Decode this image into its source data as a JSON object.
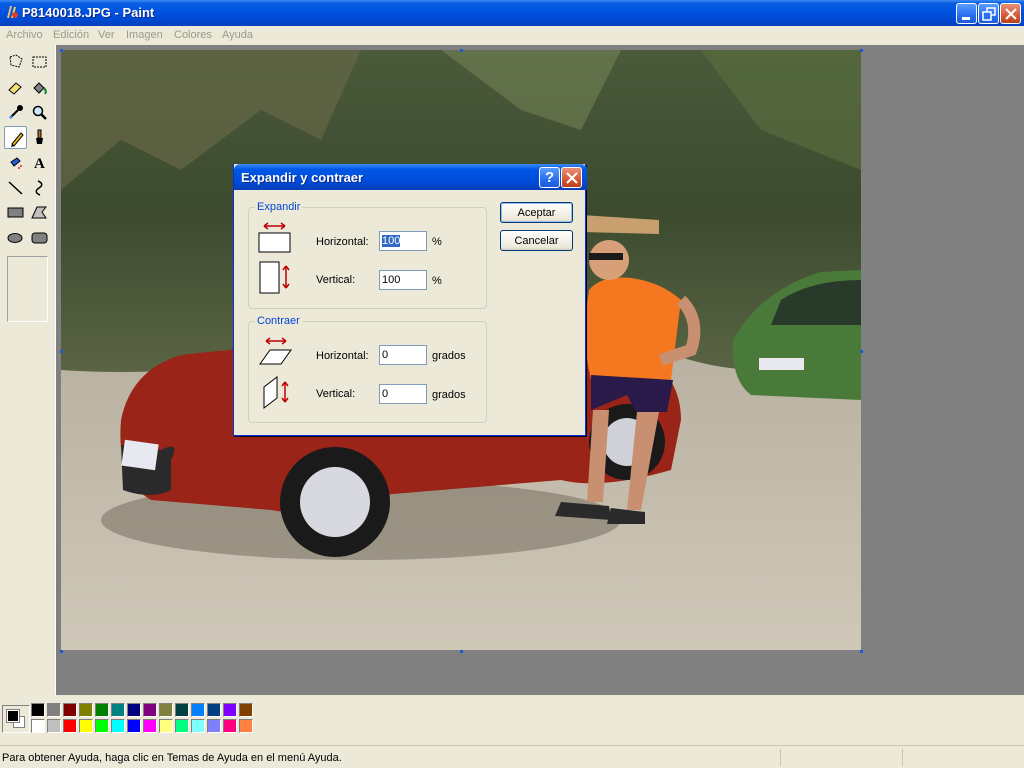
{
  "window": {
    "title": "P8140018.JPG - Paint",
    "icon": "paint-app-icon",
    "controls": [
      "minimize-icon",
      "restore-icon",
      "close-icon"
    ]
  },
  "menu": {
    "items": [
      "Archivo",
      "Edición",
      "Ver",
      "Imagen",
      "Colores",
      "Ayuda"
    ]
  },
  "tools": [
    "free-form-select-icon",
    "select-icon",
    "eraser-icon",
    "fill-icon",
    "pick-color-icon",
    "magnifier-icon",
    "pencil-icon",
    "brush-icon",
    "airbrush-icon",
    "text-icon",
    "line-icon",
    "curve-icon",
    "rectangle-icon",
    "polygon-icon",
    "ellipse-icon",
    "rounded-rectangle-icon"
  ],
  "active_tool": "pencil-icon",
  "palette": {
    "foreground": "#000000",
    "background": "#ffffff",
    "colors_top": [
      "#000000",
      "#808080",
      "#800000",
      "#808000",
      "#008000",
      "#008080",
      "#000080",
      "#800080",
      "#808040",
      "#004040",
      "#0080ff",
      "#004080",
      "#8000ff",
      "#804000"
    ],
    "colors_bottom": [
      "#ffffff",
      "#c0c0c0",
      "#ff0000",
      "#ffff00",
      "#00ff00",
      "#00ffff",
      "#0000ff",
      "#ff00ff",
      "#ffff80",
      "#00ff80",
      "#80ffff",
      "#8080ff",
      "#ff0080",
      "#ff8040"
    ]
  },
  "status": {
    "message": "Para obtener Ayuda, haga clic en Temas de Ayuda en el menú Ayuda."
  },
  "dialog": {
    "title": "Expandir y contraer",
    "help_label": "?",
    "expand": {
      "label": "Expandir",
      "horizontal_label": "Horizontal:",
      "horizontal_value": "100",
      "horizontal_unit": "%",
      "vertical_label": "Vertical:",
      "vertical_value": "100",
      "vertical_unit": "%"
    },
    "skew": {
      "label": "Contraer",
      "horizontal_label": "Horizontal:",
      "horizontal_value": "0",
      "horizontal_unit": "grados",
      "vertical_label": "Vertical:",
      "vertical_value": "0",
      "vertical_unit": "grados"
    },
    "ok_label": "Aceptar",
    "cancel_label": "Cancelar"
  },
  "colors": {
    "titlebar": "#0054e3",
    "workspace": "#808080",
    "face": "#ece9d8",
    "group_label": "#0046d5"
  }
}
